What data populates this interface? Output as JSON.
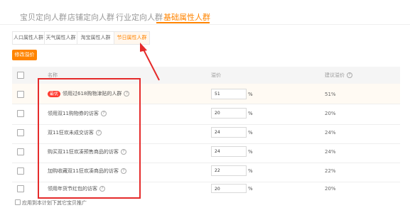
{
  "main_tabs": [
    "宝贝定向人群",
    "店铺定向人群",
    "行业定向人群",
    "基础属性人群"
  ],
  "active_main_tab": 3,
  "sub_tabs": [
    "人口属性人群",
    "天气属性人群",
    "淘宝属性人群",
    "节日属性人群"
  ],
  "active_sub_tab": 3,
  "action_button": "修改溢价",
  "table": {
    "headers": {
      "name": "名称",
      "premium": "溢价",
      "suggested": "建议溢价"
    },
    "rows": [
      {
        "badge": "最优",
        "name": "领用过618购物津贴的人群",
        "value": "51",
        "unit": "%",
        "suggested": "51%"
      },
      {
        "name": "领用双11购物券的访客",
        "value": "20",
        "unit": "%",
        "suggested": "20%"
      },
      {
        "name": "双11狂欢未成交访客",
        "value": "24",
        "unit": "%",
        "suggested": "24%"
      },
      {
        "name": "购买双11狂欢凑预售商品的访客",
        "value": "24",
        "unit": "%",
        "suggested": "24%"
      },
      {
        "name": "加购收藏双11狂欢凑商品的访客",
        "value": "22",
        "unit": "%",
        "suggested": "22%"
      },
      {
        "name": "领用年货节红包的访客",
        "value": "20",
        "unit": "%",
        "suggested": "20%"
      }
    ]
  },
  "footer_checkbox_label": "应用到本计划下其它宝贝推广",
  "colors": {
    "accent": "#ff8400",
    "annotation": "#e52b2b",
    "badge": "#ff3a30"
  },
  "icons": {
    "help": "question-circle-icon"
  }
}
